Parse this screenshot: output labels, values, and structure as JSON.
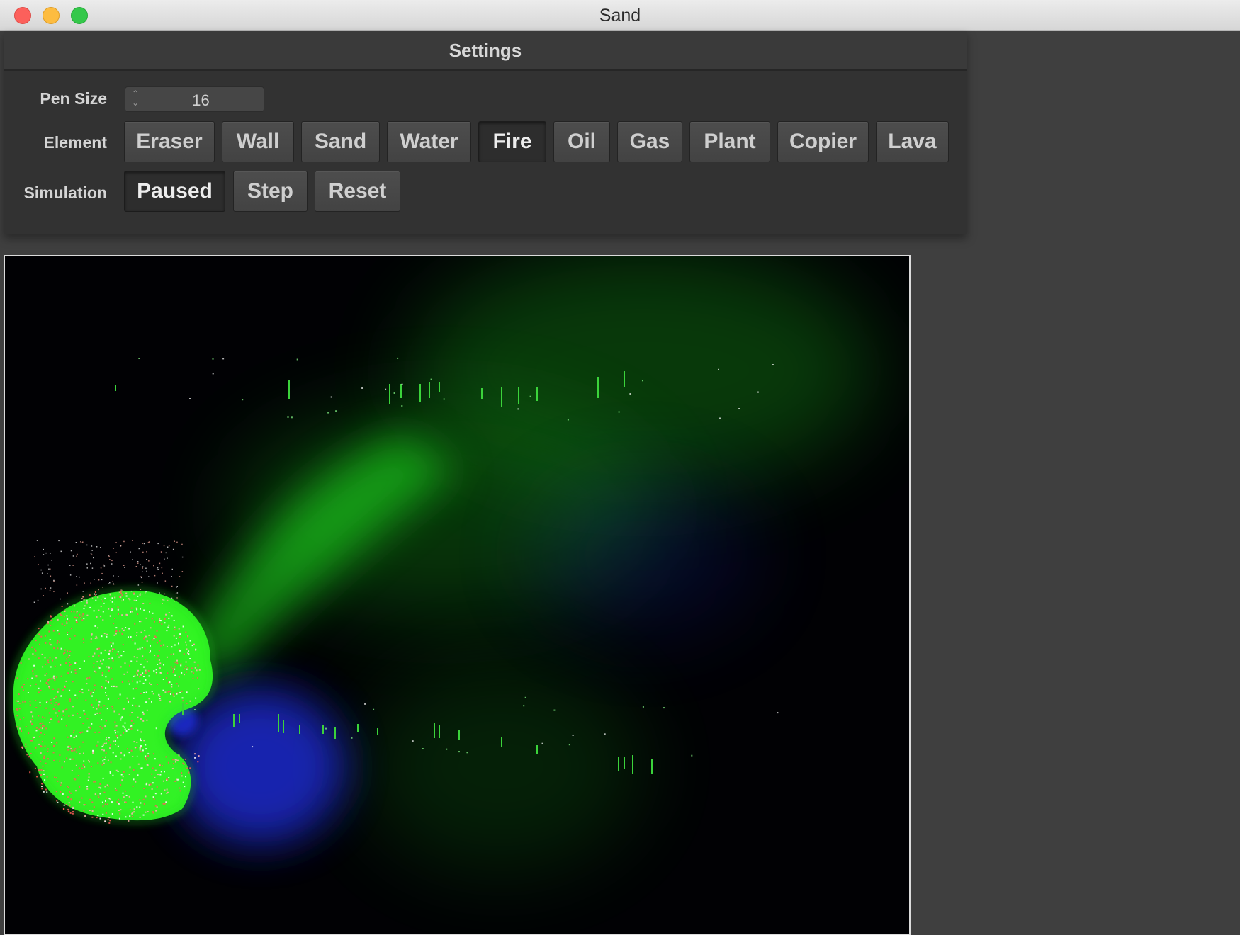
{
  "window": {
    "title": "Sand"
  },
  "settings": {
    "title": "Settings",
    "pen_size": {
      "label": "Pen Size",
      "value": "16"
    },
    "element": {
      "label": "Element",
      "options": [
        "Eraser",
        "Wall",
        "Sand",
        "Water",
        "Fire",
        "Oil",
        "Gas",
        "Plant",
        "Copier",
        "Lava"
      ],
      "selected": "Fire"
    },
    "simulation": {
      "label": "Simulation",
      "buttons": [
        "Paused",
        "Step",
        "Reset"
      ],
      "state": "Paused"
    }
  },
  "canvas": {
    "gas_color": "#22ff22",
    "fire_color": "#ff5a5a",
    "water_color": "#1a2acc",
    "plant_color": "#3bd33b"
  },
  "colors": {
    "window_bg": "#3f3f3f",
    "panel_bg": "#323232",
    "button_bg": "#484848",
    "button_active_bg": "#2d2d2d",
    "text": "#d4d4d4"
  }
}
